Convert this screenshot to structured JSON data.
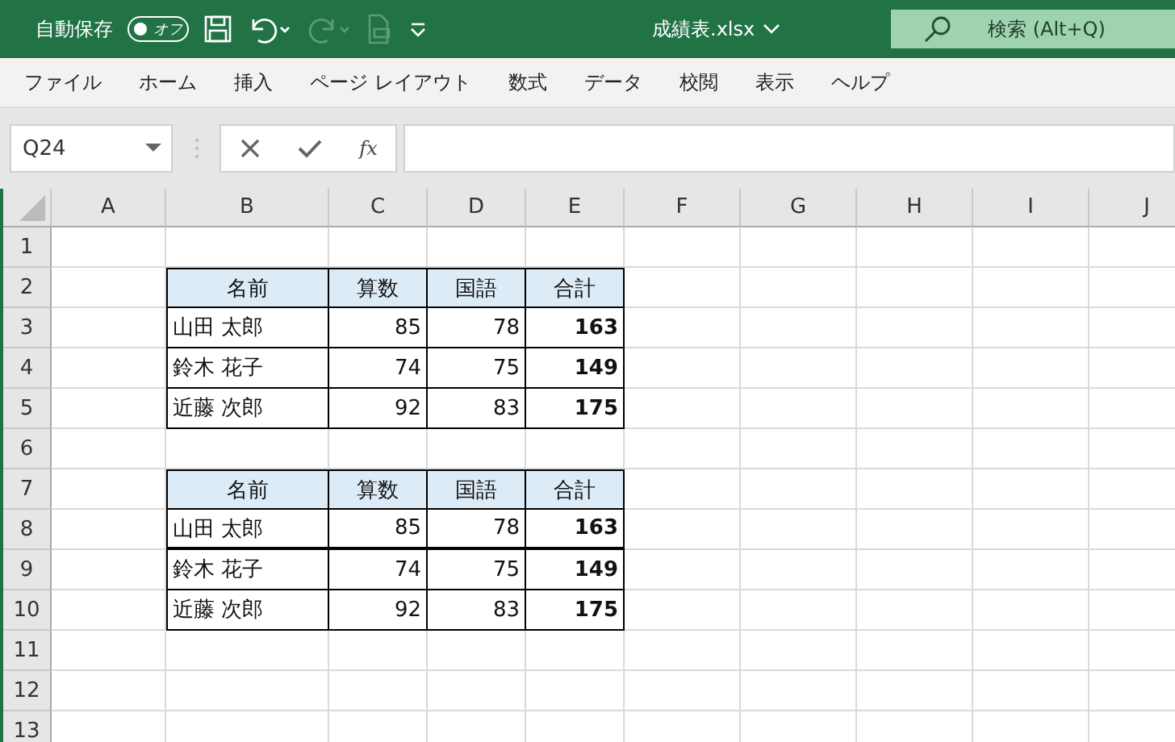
{
  "title_bar": {
    "autosave_label": "自動保存",
    "autosave_toggle": {
      "label": "オフ",
      "on": false
    },
    "file_name": "成績表.xlsx",
    "search": {
      "placeholder": "検索 (Alt+Q)"
    }
  },
  "menu": [
    {
      "label": "ファイル"
    },
    {
      "label": "ホーム"
    },
    {
      "label": "挿入"
    },
    {
      "label": "ページ レイアウト"
    },
    {
      "label": "数式"
    },
    {
      "label": "データ"
    },
    {
      "label": "校閲"
    },
    {
      "label": "表示"
    },
    {
      "label": "ヘルプ"
    }
  ],
  "formula_bar": {
    "name_box": "Q24",
    "function_label": "fx"
  },
  "sheet": {
    "column_headers": [
      "A",
      "B",
      "C",
      "D",
      "E",
      "F",
      "G",
      "H",
      "I",
      "J"
    ],
    "row_headers": [
      "1",
      "2",
      "3",
      "4",
      "5",
      "6",
      "7",
      "8",
      "9",
      "10",
      "11",
      "12",
      "13"
    ],
    "tables": [
      {
        "header": [
          "名前",
          "算数",
          "国語",
          "合計"
        ],
        "rows": [
          {
            "name": "山田 太郎",
            "math": "85",
            "japanese": "78",
            "total": "163",
            "thick_bottom": false
          },
          {
            "name": "鈴木 花子",
            "math": "74",
            "japanese": "75",
            "total": "149",
            "thick_bottom": false
          },
          {
            "name": "近藤 次郎",
            "math": "92",
            "japanese": "83",
            "total": "175",
            "thick_bottom": false
          }
        ]
      },
      {
        "header": [
          "名前",
          "算数",
          "国語",
          "合計"
        ],
        "rows": [
          {
            "name": "山田 太郎",
            "math": "85",
            "japanese": "78",
            "total": "163",
            "thick_bottom": true
          },
          {
            "name": "鈴木 花子",
            "math": "74",
            "japanese": "75",
            "total": "149",
            "thick_bottom": false
          },
          {
            "name": "近藤 次郎",
            "math": "92",
            "japanese": "83",
            "total": "175",
            "thick_bottom": false
          }
        ]
      }
    ]
  }
}
